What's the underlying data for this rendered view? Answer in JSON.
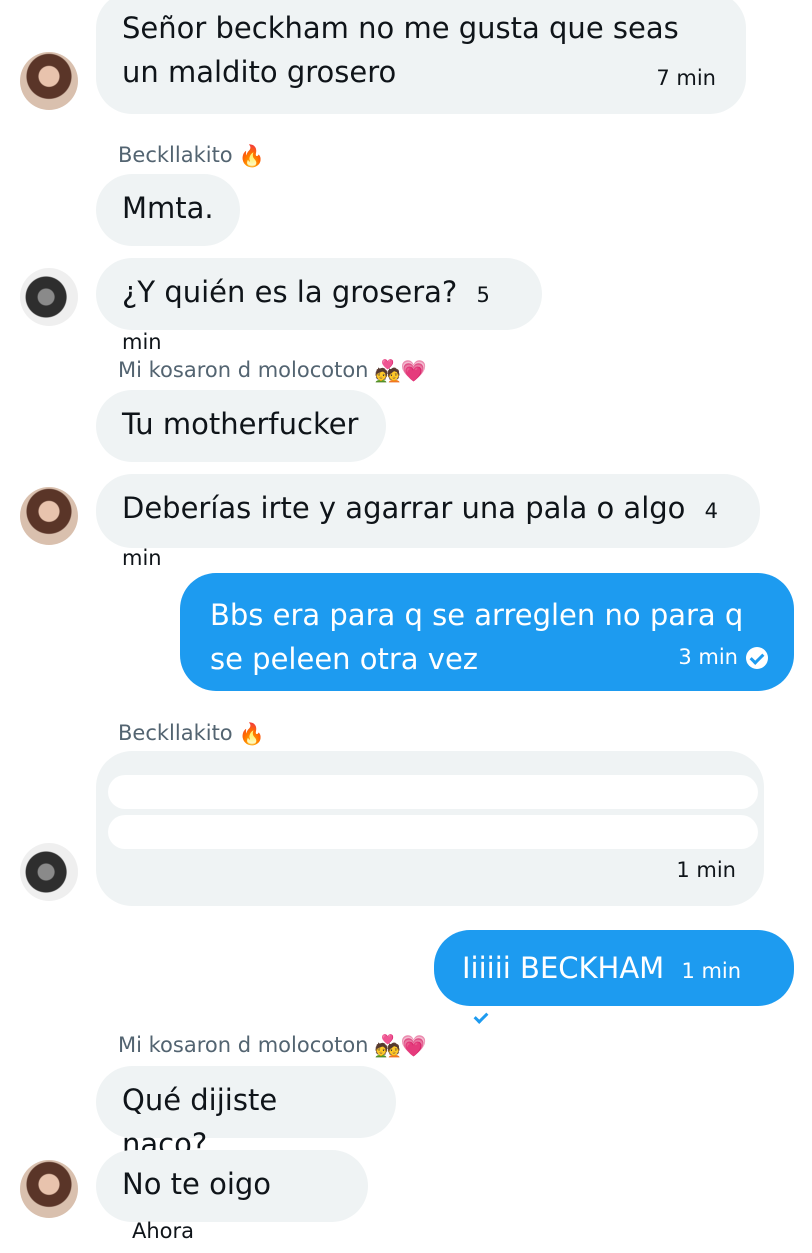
{
  "messages": [
    {
      "text": "Señor beckham no me gusta que seas un maldito grosero",
      "time": "7 min"
    },
    {
      "sender": "Beckllakito",
      "sender_emoji": "🔥",
      "text": "Mmta."
    },
    {
      "text": "¿Y quién es la grosera?",
      "time": "5 min"
    },
    {
      "sender": "Mi kosaron d molocoton",
      "sender_emoji": "💑💗",
      "text": "Tu motherfucker"
    },
    {
      "text": "Deberías irte y agarrar una pala o algo",
      "time": "4 min"
    },
    {
      "text": "Bbs era para q se arreglen no para q se peleen otra vez",
      "time": "3 min"
    },
    {
      "sender": "Beckllakito",
      "sender_emoji": "🔥",
      "time": "1 min"
    },
    {
      "text": "Iiiiii BECKHAM",
      "time": "1 min"
    },
    {
      "sender": "Mi kosaron d molocoton",
      "sender_emoji": "💑💗",
      "text": "Qué dijiste naco?"
    },
    {
      "text": "No te oigo",
      "time": "Ahora"
    }
  ],
  "colors": {
    "incoming_bg": "#eff3f4",
    "outgoing_bg": "#1d9bf0",
    "sender_text": "#536471"
  },
  "icons": {
    "read_receipt": "check-circle-icon"
  }
}
